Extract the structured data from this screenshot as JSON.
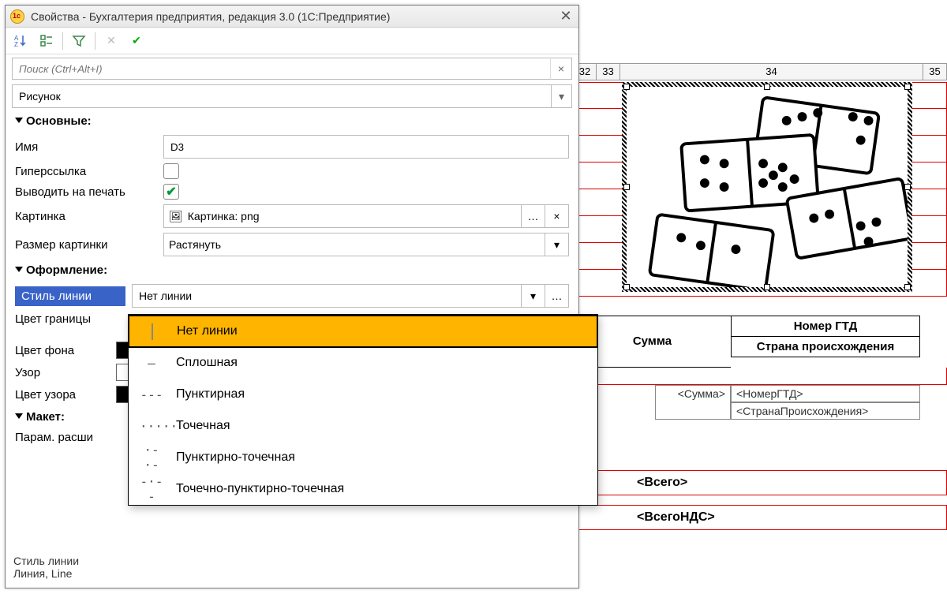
{
  "dialog": {
    "title": "Свойства - Бухгалтерия предприятия, редакция 3.0  (1С:Предприятие)",
    "search_placeholder": "Поиск (Ctrl+Alt+I)",
    "type_combo": "Рисунок",
    "sections": {
      "main": "Основные:",
      "design": "Оформление:",
      "layout": "Макет:"
    },
    "props": {
      "name_label": "Имя",
      "name_value": "D3",
      "hyperlink_label": "Гиперссылка",
      "print_label": "Выводить на печать",
      "picture_label": "Картинка",
      "picture_value": "Картинка: png",
      "size_label": "Размер картинки",
      "size_value": "Растянуть",
      "linestyle_label": "Стиль линии",
      "linestyle_value": "Нет линии",
      "bordercolor_label": "Цвет границы",
      "bgcolor_label": "Цвет фона",
      "pattern_label": "Узор",
      "patterncolor_label": "Цвет узора",
      "paramext_label": "Парам. расши"
    },
    "dropdown": [
      "Нет линии",
      "Сплошная",
      "Пунктирная",
      "Точечная",
      "Пунктирно-точечная",
      "Точечно-пунктирно-точечная"
    ],
    "dropdown_samples": [
      "",
      "—",
      "---",
      "·····",
      "·-·-",
      "-·--"
    ],
    "footer": "Стиль линии\nЛиния, Line"
  },
  "sheet": {
    "cols": [
      "32",
      "33",
      "34",
      "35"
    ],
    "headers": {
      "sum": "Сумма",
      "gtd": "Номер ГТД",
      "country": "Страна происхождения"
    },
    "placeholders": {
      "sum": "<Сумма>",
      "gtd": "<НомерГТД>",
      "country": "<СтранаПроисхождения>"
    },
    "totals": {
      "all": "<Всего>",
      "vat": "<ВсегоНДС>"
    }
  }
}
